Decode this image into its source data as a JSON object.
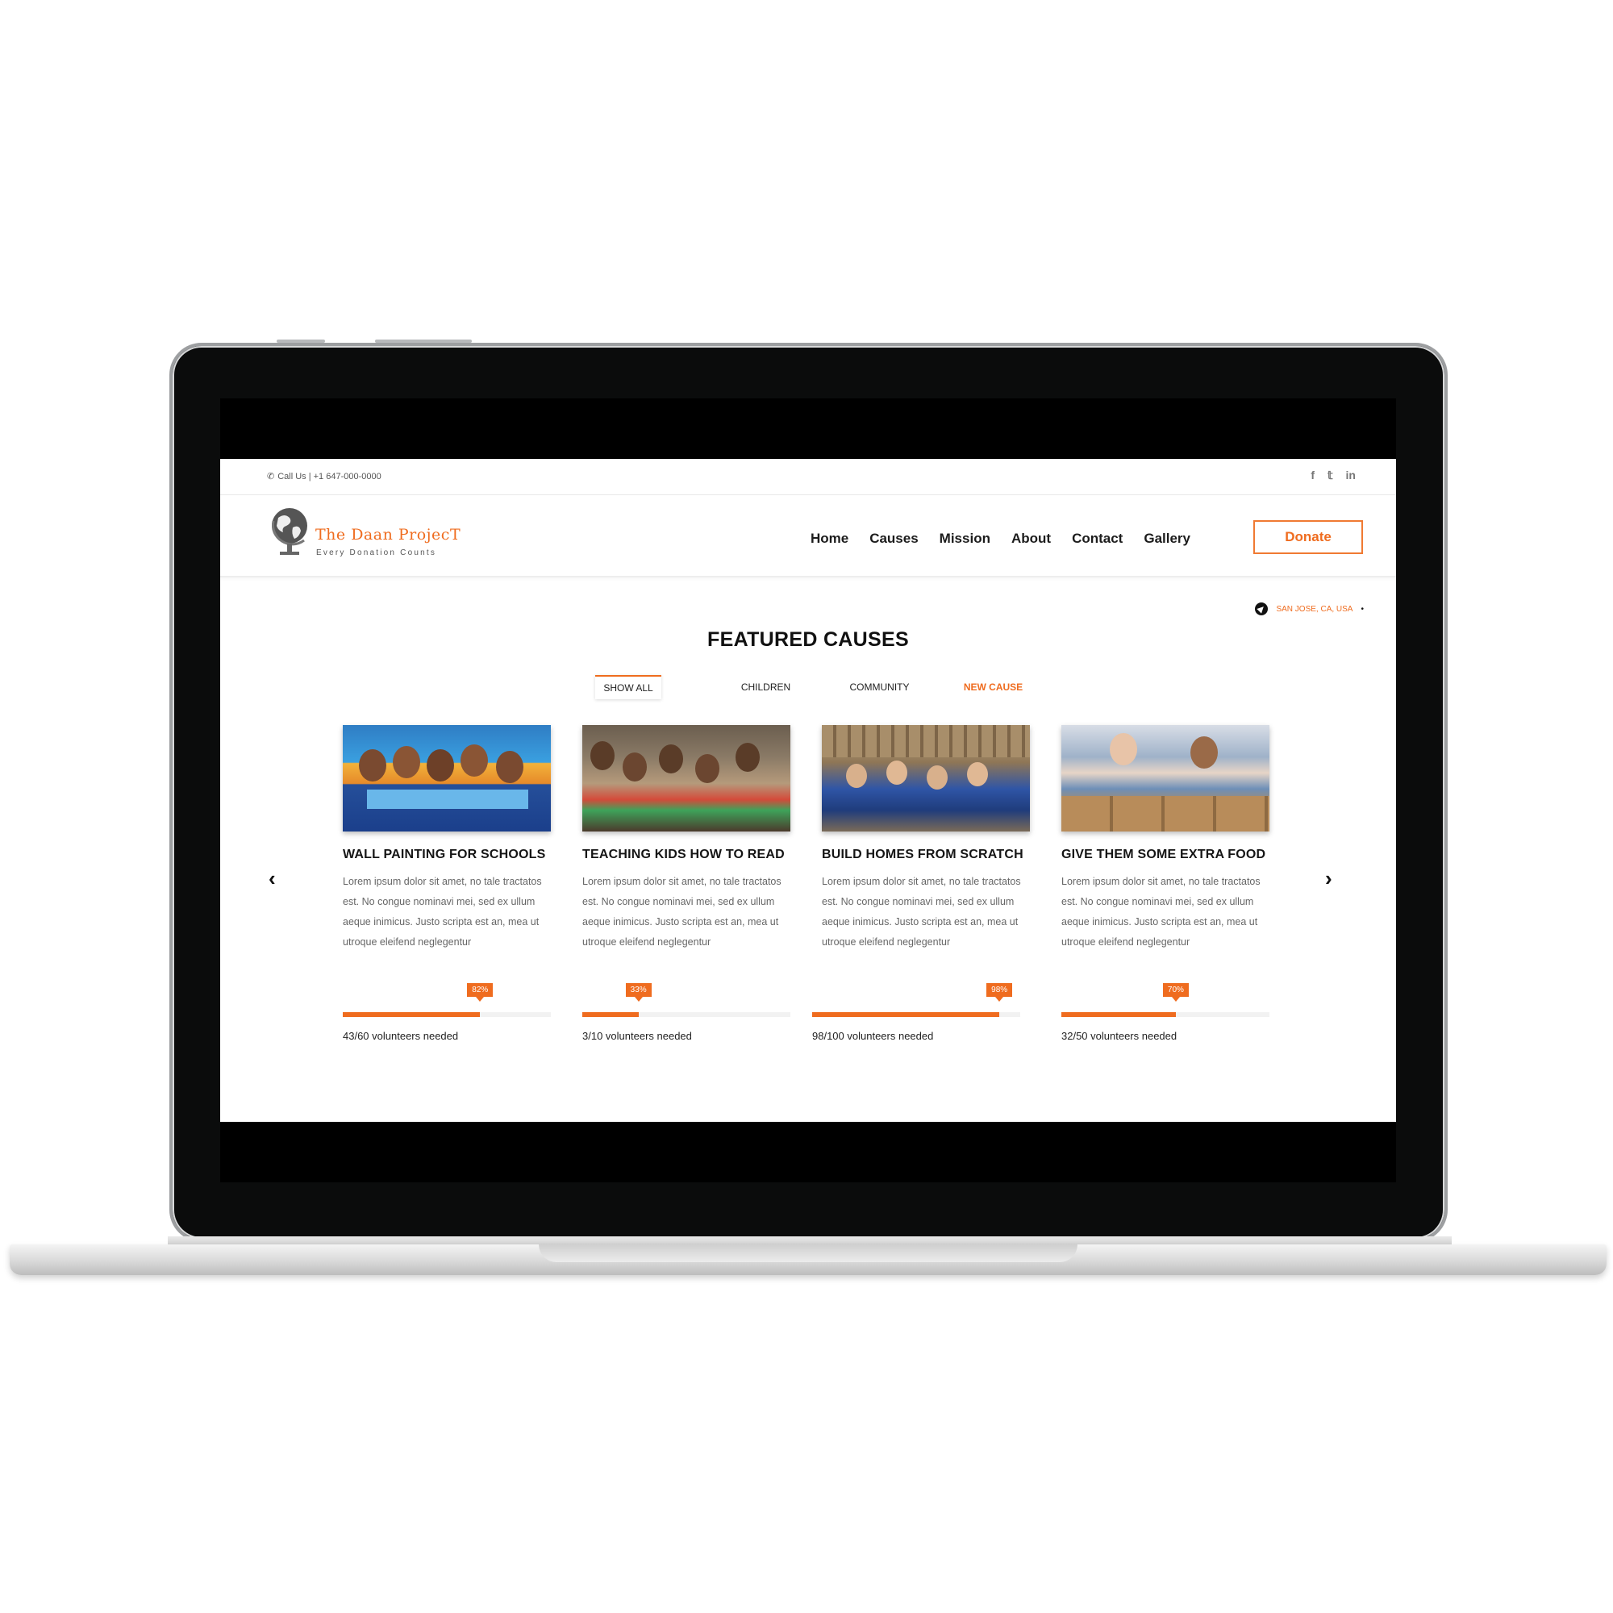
{
  "topbar": {
    "call_text": "Call Us | +1 647-000-0000",
    "social": [
      {
        "icon": "facebook-icon",
        "label": "f"
      },
      {
        "icon": "twitter-icon",
        "label": "𝕥"
      },
      {
        "icon": "linkedin-icon",
        "label": "in"
      }
    ]
  },
  "header": {
    "brand": "The Daan ProjecT",
    "tagline": "Every Donation Counts",
    "nav": [
      "Home",
      "Causes",
      "Mission",
      "About",
      "Contact",
      "Gallery"
    ],
    "donate_label": "Donate"
  },
  "location": "SAN JOSE, CA, USA",
  "section_title": "FEATURED CAUSES",
  "filters": [
    "SHOW ALL",
    "CHILDREN",
    "COMMUNITY",
    "NEW CAUSE"
  ],
  "causes": [
    {
      "title": "WALL PAINTING FOR SCHOOLS",
      "desc": "Lorem ipsum dolor sit amet, no tale tractatos est. No congue nominavi mei, sed ex ullum aeque inimicus. Justo scripta est an, mea ut utroque eleifend neglegentur",
      "percent_label": "82%",
      "percent": 0.66,
      "volunteers": "43/60 volunteers needed"
    },
    {
      "title": "TEACHING KIDS HOW TO READ",
      "desc": "Lorem ipsum dolor sit amet, no tale tractatos est. No congue nominavi mei, sed ex ullum aeque inimicus. Justo scripta est an, mea ut utroque eleifend neglegentur",
      "percent_label": "33%",
      "percent": 0.27,
      "volunteers": "3/10 volunteers needed"
    },
    {
      "title": "BUILD HOMES FROM SCRATCH",
      "desc": "Lorem ipsum dolor sit amet, no tale tractatos est. No congue nominavi mei, sed ex ullum aeque inimicus. Justo scripta est an, mea ut utroque eleifend neglegentur",
      "percent_label": "98%",
      "percent": 0.9,
      "volunteers": "98/100 volunteers needed"
    },
    {
      "title": "GIVE THEM SOME EXTRA FOOD",
      "desc": "Lorem ipsum dolor sit amet, no tale tractatos est. No congue nominavi mei, sed ex ullum aeque inimicus. Justo scripta est an, mea ut utroque eleifend neglegentur",
      "percent_label": "70%",
      "percent": 0.55,
      "volunteers": "32/50 volunteers needed"
    }
  ],
  "colors": {
    "accent": "#ef6c1f",
    "text": "#151515"
  }
}
